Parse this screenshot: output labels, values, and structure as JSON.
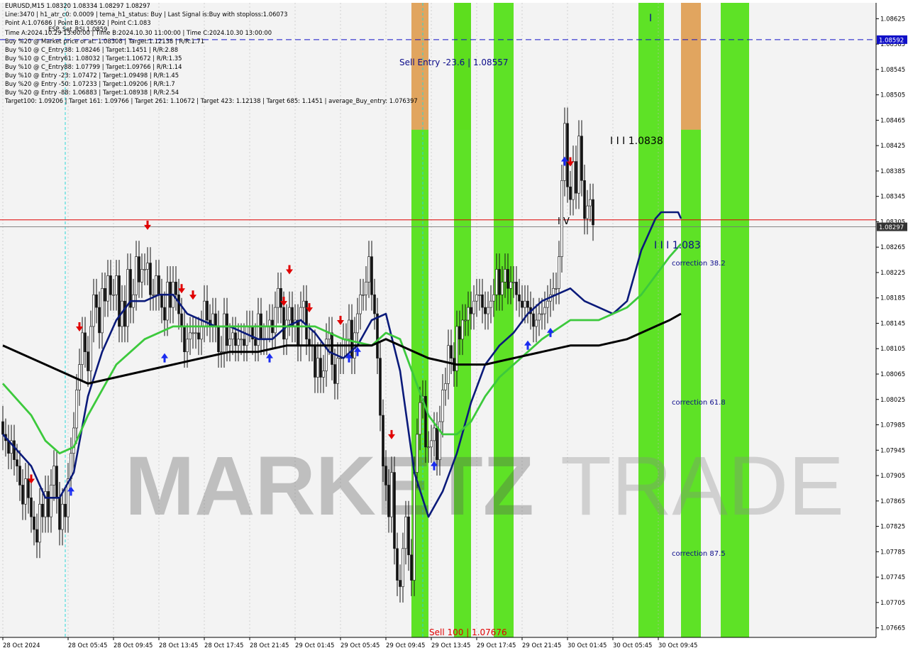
{
  "header": {
    "lines": [
      "EURUSD,M15  1.08320 1.08334 1.08297 1.08297",
      "Line:3470  |  h1_atr_c0: 0.0009  |  tema_h1_status: Buy  |  Last Signal is:Buy with stoploss:1.06073",
      "Point A:1.07686  |  Point B:1.08592  |  Point C:1.083",
      "Time A:2024.10.29 13:00:00  |  Time B:2024.10.30 11:00:00  |  Time C:2024.10.30 13:00:00",
      "Buy %20 @ Market price or at: 1.08308  |  Target:1.12138  |  R/R:1.71",
      "Buy %10 @ C_Entry38: 1.08246  |  Target:1.1451  |  R/R:2.88",
      "Buy %10 @ C_Entry61: 1.08032  |  Target:1.10672  |  R/R:1.35",
      "Buy %10 @ C_Entry88: 1.07799  |  Target:1.09766  |  R/R:1.14",
      "Buy %10 @ Entry -23: 1.07472  |  Target:1.09498  |  R/R:1.45",
      "Buy %20 @ Entry -50: 1.07233  |  Target:1.09206  |  R/R:1.7",
      "Buy %20 @ Entry -88: 1.06883  |  Target:1.08938  |  R/R:2.54",
      "Target100: 1.09206  |  Target 161: 1.09766  |  Target 261: 1.10672  |  Target 423: 1.12138  |  Target 685: 1.1451  |  average_Buy_entry: 1.076397"
    ],
    "overlap_label": "ESP_Set_RSI 1.0859"
  },
  "annotations": {
    "sell_entry": "Sell Entry -23.6 | 1.08557",
    "sell_100": "Sell 100 | 1.07676",
    "wave_label": "I I I 1.0838",
    "iv_label": "I V",
    "i_label": "I",
    "iii_label": "I I I 1.083",
    "correction_382": "correction 38.2",
    "correction_618": "correction 61.8",
    "correction_875": "correction 87.5"
  },
  "watermark": {
    "part1": "MARKETZ",
    "part2": "TRADE"
  },
  "colors": {
    "bull": "#55e01a",
    "bear": "#e8a162",
    "ema_fast": "#0a1a7a",
    "ema_mid": "#3cc93c",
    "ema_slow": "#000000",
    "price_red": "#e00000",
    "level_blue": "#1010c8"
  },
  "chart_data": {
    "type": "candlestick",
    "symbol": "EURUSD",
    "timeframe": "M15",
    "ohlc_last": {
      "open": 1.0832,
      "high": 1.08334,
      "low": 1.08297,
      "close": 1.08297
    },
    "ylim": [
      1.0765,
      1.0865
    ],
    "y_ticks": [
      "1.08625",
      "1.08585",
      "1.08545",
      "1.08505",
      "1.08465",
      "1.08425",
      "1.08385",
      "1.08345",
      "1.08305",
      "1.08265",
      "1.08225",
      "1.08185",
      "1.08145",
      "1.08105",
      "1.08065",
      "1.08025",
      "1.07985",
      "1.07945",
      "1.07905",
      "1.07865",
      "1.07825",
      "1.07785",
      "1.07745",
      "1.07705",
      "1.07665"
    ],
    "x_ticks": [
      "28 Oct 2024",
      "28 Oct 05:45",
      "28 Oct 09:45",
      "28 Oct 13:45",
      "28 Oct 17:45",
      "28 Oct 21:45",
      "29 Oct 01:45",
      "29 Oct 05:45",
      "29 Oct 09:45",
      "29 Oct 13:45",
      "29 Oct 17:45",
      "29 Oct 21:45",
      "30 Oct 01:45",
      "30 Oct 05:45",
      "30 Oct 09:45"
    ],
    "x_tick_index": [
      0,
      23,
      39,
      55,
      71,
      87,
      103,
      119,
      135,
      151,
      167,
      183,
      199,
      215,
      231
    ],
    "current_price": {
      "label": "1.08297",
      "value": 1.08297
    },
    "point_b_price": {
      "label": "1.08592",
      "value": 1.08592
    },
    "red_level": 1.08308,
    "close": [
      1.0797,
      1.0796,
      1.0794,
      1.0796,
      1.0793,
      1.0792,
      1.0789,
      1.0786,
      1.079,
      1.0787,
      1.0784,
      1.0782,
      1.078,
      1.0786,
      1.0784,
      1.0788,
      1.0784,
      1.0789,
      1.0792,
      1.0787,
      1.0782,
      1.0786,
      1.0784,
      1.079,
      1.0794,
      1.0798,
      1.0804,
      1.0808,
      1.0813,
      1.081,
      1.0807,
      1.0814,
      1.0819,
      1.0817,
      1.0813,
      1.082,
      1.0818,
      1.0822,
      1.0819,
      1.0819,
      1.0822,
      1.0814,
      1.0818,
      1.0814,
      1.0823,
      1.0817,
      1.0819,
      1.0825,
      1.0821,
      1.0823,
      1.0823,
      1.0824,
      1.0819,
      1.0819,
      1.0822,
      1.0819,
      1.0817,
      1.0815,
      1.0821,
      1.0817,
      1.0821,
      1.0819,
      1.0816,
      1.0814,
      1.081,
      1.0812,
      1.0813,
      1.0813,
      1.0813,
      1.0812,
      1.0814,
      1.0818,
      1.0815,
      1.0814,
      1.0816,
      1.0814,
      1.081,
      1.081,
      1.0816,
      1.0811,
      1.0812,
      1.0813,
      1.0811,
      1.0812,
      1.0812,
      1.0811,
      1.0814,
      1.0814,
      1.0812,
      1.0811,
      1.0816,
      1.0812,
      1.0812,
      1.0814,
      1.0815,
      1.0813,
      1.0817,
      1.082,
      1.0817,
      1.0812,
      1.0815,
      1.0817,
      1.0814,
      1.0815,
      1.0811,
      1.0817,
      1.0818,
      1.0812,
      1.0811,
      1.0811,
      1.0806,
      1.0809,
      1.0806,
      1.0807,
      1.0812,
      1.0813,
      1.0808,
      1.0805,
      1.0809,
      1.0809,
      1.0812,
      1.0812,
      1.0815,
      1.0809,
      1.0813,
      1.0816,
      1.0819,
      1.0819,
      1.0821,
      1.0825,
      1.0819,
      1.0816,
      1.0809,
      1.08,
      1.0792,
      1.0789,
      1.0784,
      1.0791,
      1.0779,
      1.0774,
      1.0773,
      1.0779,
      1.0784,
      1.0778,
      1.0774,
      1.0791,
      1.0797,
      1.0802,
      1.0803,
      1.0795,
      1.0795,
      1.0796,
      1.0798,
      1.0793,
      1.0799,
      1.0804,
      1.0805,
      1.0811,
      1.0809,
      1.0807,
      1.0814,
      1.0812,
      1.0815,
      1.0815,
      1.0817,
      1.0816,
      1.0818,
      1.0819,
      1.0819,
      1.0817,
      1.0816,
      1.0817,
      1.0818,
      1.0819,
      1.0823,
      1.0819,
      1.0821,
      1.0823,
      1.082,
      1.0821,
      1.0821,
      1.0819,
      1.0818,
      1.0817,
      1.0818,
      1.0817,
      1.0816,
      1.0814,
      1.0815,
      1.0816,
      1.0816,
      1.0817,
      1.0818,
      1.0819,
      1.082,
      1.082,
      1.0825,
      1.0837,
      1.0846,
      1.0836,
      1.0834,
      1.084,
      1.0835,
      1.0844,
      1.0837,
      1.0831,
      1.0833,
      1.0834,
      1.083
    ],
    "series": [
      {
        "name": "",
        "role": "fast",
        "x": [
          0,
          10,
          15,
          20,
          25,
          30,
          35,
          40,
          45,
          50,
          55,
          60,
          65,
          70,
          75,
          80,
          85,
          90,
          95,
          100,
          105,
          110,
          115,
          120,
          125,
          130,
          135,
          140,
          145,
          150,
          155,
          160,
          165,
          170,
          175,
          180,
          185,
          190,
          195,
          200,
          205,
          210,
          215,
          220,
          225,
          230,
          232,
          235,
          238,
          239
        ],
        "y": [
          1.0797,
          1.0792,
          1.0787,
          1.0787,
          1.0791,
          1.0803,
          1.081,
          1.0815,
          1.0818,
          1.0818,
          1.0819,
          1.0819,
          1.0816,
          1.0815,
          1.0814,
          1.0814,
          1.0813,
          1.0812,
          1.0812,
          1.0814,
          1.0815,
          1.0813,
          1.081,
          1.0809,
          1.0811,
          1.0815,
          1.0816,
          1.0807,
          1.0791,
          1.0784,
          1.0788,
          1.0794,
          1.0802,
          1.0808,
          1.0811,
          1.0813,
          1.0816,
          1.0818,
          1.0819,
          1.082,
          1.0818,
          1.0817,
          1.0816,
          1.0818,
          1.0826,
          1.0831,
          1.0832,
          1.0832,
          1.0832,
          1.0831
        ]
      },
      {
        "name": "",
        "role": "mid",
        "x": [
          0,
          10,
          15,
          20,
          25,
          30,
          40,
          50,
          60,
          70,
          80,
          90,
          100,
          110,
          120,
          130,
          135,
          140,
          145,
          150,
          155,
          160,
          165,
          170,
          175,
          180,
          190,
          200,
          210,
          215,
          220,
          225,
          230,
          235,
          239
        ],
        "y": [
          1.0805,
          1.08,
          1.0796,
          1.0794,
          1.0795,
          1.08,
          1.0808,
          1.0812,
          1.0814,
          1.0814,
          1.0814,
          1.0814,
          1.0814,
          1.0814,
          1.0812,
          1.0811,
          1.0813,
          1.0812,
          1.0806,
          1.08,
          1.0797,
          1.0797,
          1.0799,
          1.0803,
          1.0806,
          1.0808,
          1.0812,
          1.0815,
          1.0815,
          1.0816,
          1.0817,
          1.0819,
          1.0822,
          1.0825,
          1.0827
        ]
      },
      {
        "name": "",
        "role": "slow",
        "x": [
          0,
          10,
          20,
          30,
          40,
          50,
          60,
          70,
          80,
          90,
          100,
          110,
          120,
          130,
          135,
          140,
          145,
          150,
          160,
          170,
          180,
          190,
          200,
          210,
          220,
          225,
          230,
          235,
          239
        ],
        "y": [
          1.0811,
          1.0809,
          1.0807,
          1.0805,
          1.0806,
          1.0807,
          1.0808,
          1.0809,
          1.081,
          1.081,
          1.0811,
          1.0811,
          1.0811,
          1.0811,
          1.0812,
          1.0811,
          1.081,
          1.0809,
          1.0808,
          1.0808,
          1.0809,
          1.081,
          1.0811,
          1.0811,
          1.0812,
          1.0813,
          1.0814,
          1.0815,
          1.0816
        ]
      }
    ],
    "zones": [
      {
        "type": "buy",
        "x0": 144,
        "x1": 150
      },
      {
        "type": "sell",
        "x0": 144,
        "x1": 150
      },
      {
        "type": "sell",
        "x0": 159,
        "x1": 165
      },
      {
        "type": "buy",
        "x0": 159,
        "x1": 165
      },
      {
        "type": "buy",
        "x0": 173,
        "x1": 180
      },
      {
        "type": "buy",
        "x0": 224,
        "x1": 233
      },
      {
        "type": "buy",
        "x0": 239,
        "x1": 246
      },
      {
        "type": "sell",
        "x0": 239,
        "x1": 246
      },
      {
        "type": "buy",
        "x0": 253,
        "x1": 263
      }
    ],
    "buy_arrows": [
      24,
      57,
      94,
      122,
      125,
      152,
      185,
      193,
      198,
      217,
      226
    ],
    "sell_arrows": [
      10,
      27,
      51,
      63,
      67,
      99,
      101,
      108,
      119,
      137,
      200,
      222,
      238
    ]
  }
}
